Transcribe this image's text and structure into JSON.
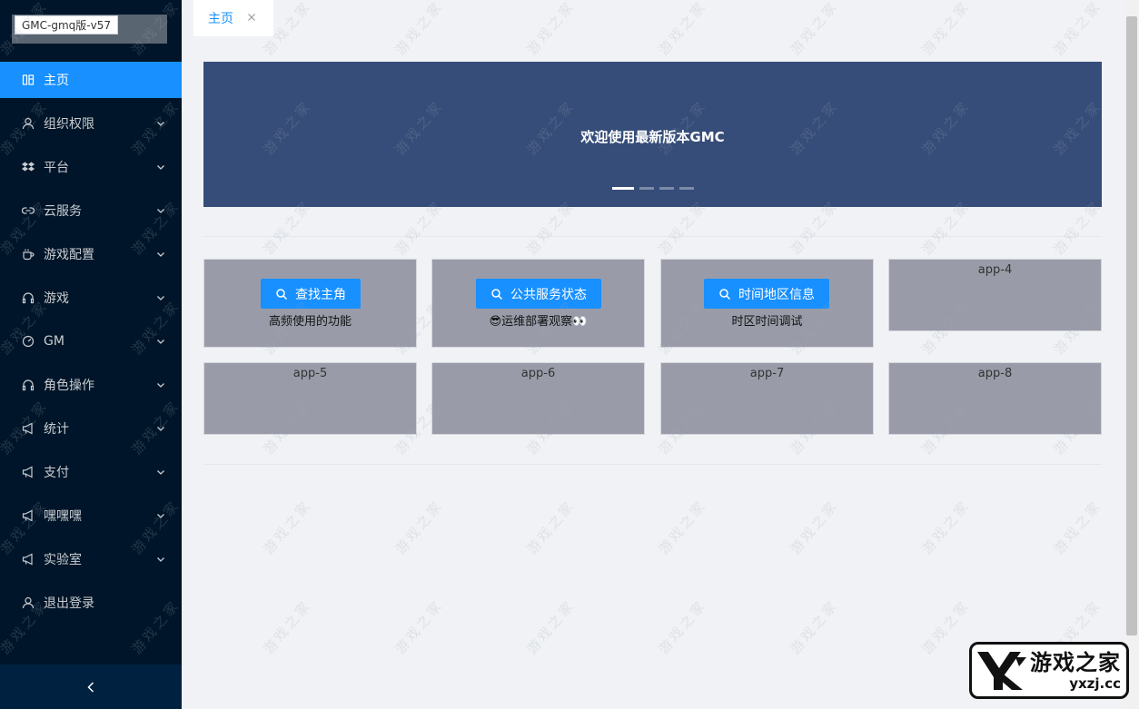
{
  "app": {
    "version_tag": "GMC-gmq版-v57"
  },
  "sidebar": {
    "items": [
      {
        "label": "主页",
        "icon": "home-icon",
        "active": true
      },
      {
        "label": "组织权限",
        "icon": "user-icon"
      },
      {
        "label": "平台",
        "icon": "dropbox-icon"
      },
      {
        "label": "云服务",
        "icon": "link-icon"
      },
      {
        "label": "游戏配置",
        "icon": "coffee-icon"
      },
      {
        "label": "游戏",
        "icon": "headset-icon"
      },
      {
        "label": "GM",
        "icon": "dashboard-icon"
      },
      {
        "label": "角色操作",
        "icon": "headset-icon"
      },
      {
        "label": "统计",
        "icon": "sound-icon"
      },
      {
        "label": "支付",
        "icon": "sound-icon"
      },
      {
        "label": "嘿嘿嘿",
        "icon": "sound-icon"
      },
      {
        "label": "实验室",
        "icon": "sound-icon"
      },
      {
        "label": "退出登录",
        "icon": "user-icon"
      }
    ]
  },
  "tabs": [
    {
      "label": "主页"
    }
  ],
  "banner": {
    "title": "欢迎使用最新版本GMC"
  },
  "cards": [
    {
      "title": "",
      "button": "查找主角",
      "subtitle": "高频使用的功能"
    },
    {
      "title": "",
      "button": "公共服务状态",
      "subtitle": "😎运维部署观察👀"
    },
    {
      "title": "",
      "button": "时间地区信息",
      "subtitle": "时区时间调试"
    },
    {
      "title": "app-4"
    },
    {
      "title": "app-5"
    },
    {
      "title": "app-6"
    },
    {
      "title": "app-7"
    },
    {
      "title": "app-8"
    }
  ],
  "watermark": {
    "text": "游戏之家"
  },
  "site_logo": {
    "name": "游戏之家",
    "domain": "yxzj.cc"
  },
  "colors": {
    "sidebar": "#001529",
    "primary": "#1890ff",
    "banner": "#364d79",
    "card": "#999ca8"
  }
}
